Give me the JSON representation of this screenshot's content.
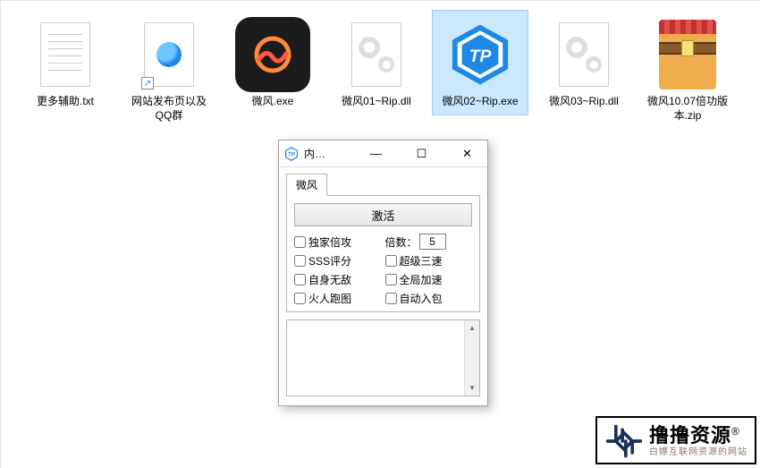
{
  "files": [
    {
      "name": "更多辅助.txt",
      "kind": "txt"
    },
    {
      "name": "网站发布页以及QQ群",
      "kind": "link"
    },
    {
      "name": "微风.exe",
      "kind": "weifeng"
    },
    {
      "name": "微风01~Rip.dll",
      "kind": "dll"
    },
    {
      "name": "微风02~Rip.exe",
      "kind": "tp",
      "selected": true
    },
    {
      "name": "微风03~Rip.dll",
      "kind": "dll"
    },
    {
      "name": "微风10.07倍功版本.zip",
      "kind": "zip"
    }
  ],
  "dialog": {
    "title": "内…",
    "tab_label": "微风",
    "activate_label": "激活",
    "multiplier_label": "倍数：",
    "multiplier_value": "5",
    "checkboxes": {
      "exclusive_multi_attack": "独家倍攻",
      "sss_rating": "SSS评分",
      "self_invincible": "自身无敌",
      "fireman_run": "火人跑图",
      "super_triple_speed": "超级三速",
      "global_speedup": "全局加速",
      "auto_pickup": "自动入包"
    },
    "buttons": {
      "minimize": "—",
      "maximize": "☐",
      "close": "✕"
    },
    "scroll": {
      "up": "▴",
      "down": "▾"
    }
  },
  "watermark": {
    "main": "撸撸资源",
    "reg": "®",
    "sub": "白嫖互联网资源的网站"
  }
}
